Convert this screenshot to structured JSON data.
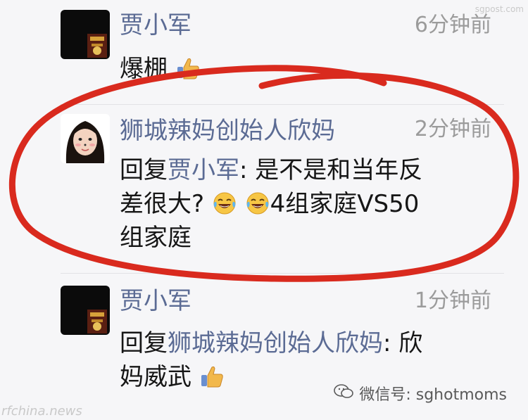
{
  "comments": [
    {
      "author": "贾小军",
      "time": "6分钟前",
      "text": "爆棚",
      "emoji": "thumbs-up"
    },
    {
      "author": "狮城辣妈创始人欣妈",
      "time": "2分钟前",
      "reply_prefix": "回复",
      "reply_to": "贾小军",
      "line1_rest": ": 是不是和当年反",
      "line2_start": "差很大?",
      "line2_end": "4组家庭VS50",
      "line3": "组家庭",
      "emoji": "laughing-tears"
    },
    {
      "author": "贾小军",
      "time": "1分钟前",
      "reply_prefix": "回复",
      "reply_to": "狮城辣妈创始人欣妈",
      "line1_rest": ": 欣",
      "line2": "妈威武",
      "emoji": "thumbs-up"
    }
  ],
  "watermarks": {
    "wechat": "微信号: sghotmoms",
    "bottom_left": "rfchina.news",
    "top_right": "sgpost.com"
  },
  "colors": {
    "name": "#5b6b94",
    "time": "#9b9b9b",
    "text": "#161616",
    "circle": "#d92a1e",
    "background": "#f6f6f8"
  }
}
